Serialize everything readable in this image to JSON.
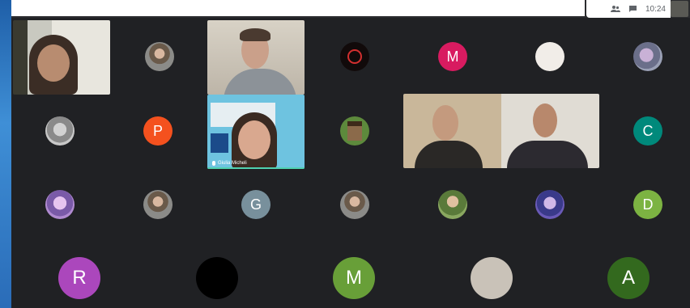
{
  "toolbar": {
    "time": "10:24",
    "icons": [
      "people-icon",
      "chat-icon"
    ]
  },
  "participants_avatars": [
    {
      "name": "avatar-m-pink",
      "letter": "M",
      "color": "#d81b60"
    },
    {
      "name": "avatar-p-orange",
      "letter": "P",
      "color": "#f4511e"
    },
    {
      "name": "avatar-c-teal",
      "letter": "C",
      "color": "#00897b"
    },
    {
      "name": "avatar-g-grey",
      "letter": "G",
      "color": "#78909c"
    },
    {
      "name": "avatar-d-green",
      "letter": "D",
      "color": "#7cb342"
    },
    {
      "name": "avatar-r-purple",
      "letter": "R",
      "color": "#ab47bc"
    },
    {
      "name": "avatar-m-green",
      "letter": "M",
      "color": "#689f38"
    },
    {
      "name": "avatar-a-darkgreen",
      "letter": "A",
      "color": "#33691e"
    }
  ],
  "video_tiles": {
    "presenter_name": "Giulia Micheli"
  },
  "colors": {
    "background": "#202124",
    "speaking_indicator": "#4fd1b0"
  }
}
